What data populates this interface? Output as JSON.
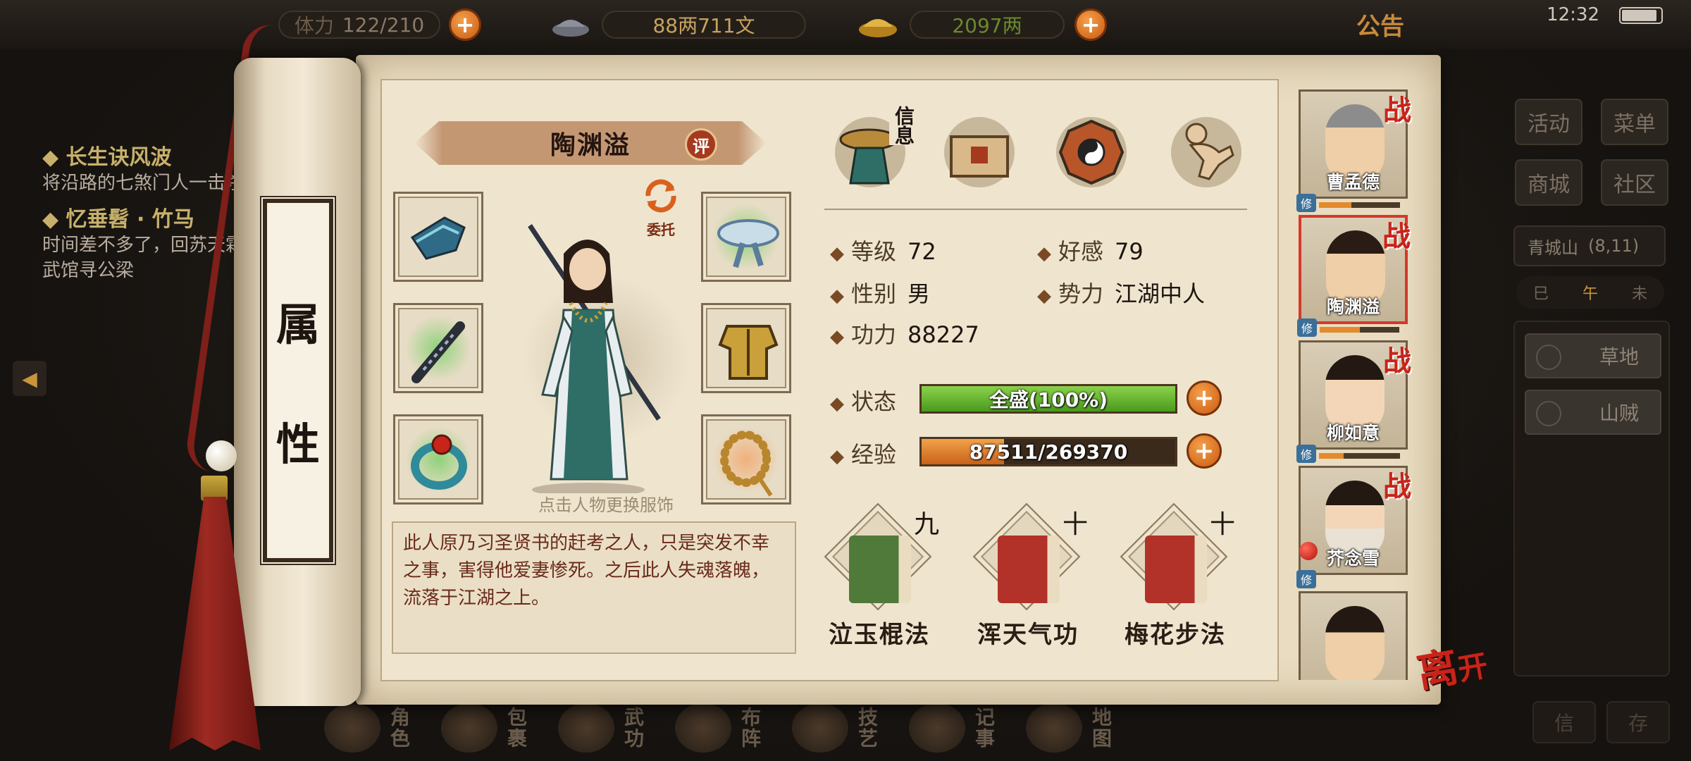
{
  "topbar": {
    "stamina": "122/210",
    "stamina_label": "体力",
    "silver": "88两711文",
    "gold": "2097两",
    "notice": "公告",
    "clock": "12:32"
  },
  "quests": [
    {
      "title": "长生诀风波",
      "text": "将沿路的七煞门人一击杀"
    },
    {
      "title": "忆垂髫 · 竹马",
      "text": "时间差不多了，回苏天霜武馆寻公梁"
    }
  ],
  "sidemenu": {
    "activity": "活动",
    "menu": "菜单",
    "shop": "商城",
    "community": "社区",
    "location_name": "青城山",
    "location_coords": "(8,11)",
    "timeline": [
      "巳",
      "午",
      "未"
    ],
    "nearby": [
      "草地",
      "山贼"
    ],
    "corner_left": "信",
    "corner_right": "存"
  },
  "bottomnav": [
    "角色",
    "包裹",
    "武功",
    "布阵",
    "技艺",
    "记事",
    "地图"
  ],
  "scroll": {
    "title_top": "属",
    "title_bottom": "性"
  },
  "character": {
    "name": "陶渊溢",
    "rate_badge": "评",
    "entrust": "委托",
    "hint": "点击人物更换服饰",
    "description": "此人原乃习圣贤书的赶考之人，只是突发不幸之事，害得他爱妻惨死。之后此人失魂落魄，流落于江湖之上。"
  },
  "tabs": {
    "info_label": "信息"
  },
  "stats": {
    "level_k": "等级",
    "level_v": "72",
    "favor_k": "好感",
    "favor_v": "79",
    "gender_k": "性别",
    "gender_v": "男",
    "faction_k": "势力",
    "faction_v": "江湖中人",
    "power_k": "功力",
    "power_v": "88227",
    "status_k": "状态",
    "status_v": "全盛(100%)",
    "status_fraction": 1.0,
    "exp_k": "经验",
    "exp_v": "87511/269370",
    "exp_fraction": 0.325
  },
  "skills": [
    {
      "name": "泣玉棍法",
      "level": "九",
      "color": "#4f7a3a"
    },
    {
      "name": "浑天气功",
      "level": "十",
      "color": "#b2322a"
    },
    {
      "name": "梅花步法",
      "level": "十",
      "color": "#b2322a"
    }
  ],
  "companions": [
    {
      "name": "曹孟德",
      "zhan": "战",
      "xiu": "修",
      "xp": 0.4
    },
    {
      "name": "陶渊溢",
      "zhan": "战",
      "xiu": "修",
      "xp": 0.5
    },
    {
      "name": "柳如意",
      "zhan": "战",
      "xiu": "修",
      "xp": 0.3
    },
    {
      "name": "芥念雪",
      "zhan": "战",
      "xiu": "修",
      "xp": 0.2
    },
    {
      "name": "",
      "zhan": "",
      "xiu": "",
      "xp": 0
    }
  ],
  "leave": {
    "big": "离",
    "small": "开"
  },
  "colors": {
    "accent": "#c95a12",
    "status_green": "#5aa52a",
    "exp_orange": "#d9761e",
    "red": "#c8241a"
  }
}
